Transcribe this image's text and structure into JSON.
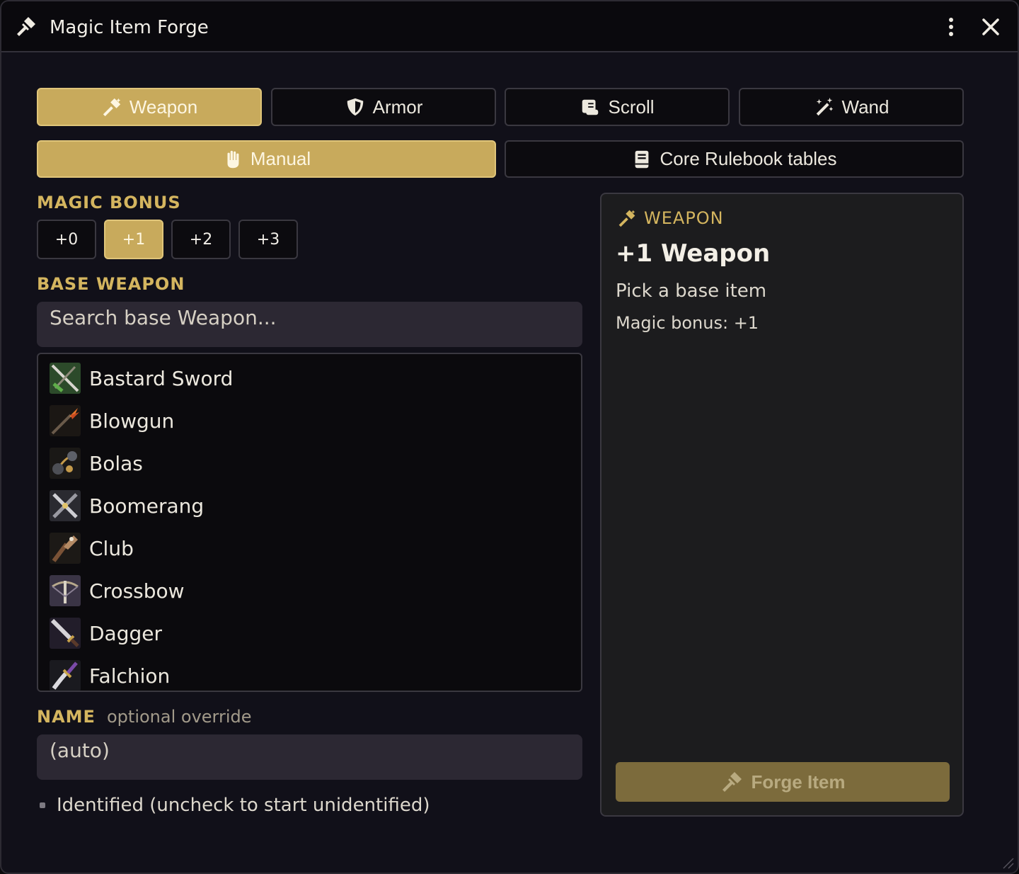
{
  "window": {
    "title": "Magic Item Forge"
  },
  "item_types": [
    {
      "label": "Weapon",
      "icon": "hammer-icon",
      "active": true
    },
    {
      "label": "Armor",
      "icon": "shield-icon",
      "active": false
    },
    {
      "label": "Scroll",
      "icon": "scroll-icon",
      "active": false
    },
    {
      "label": "Wand",
      "icon": "magic-wand-icon",
      "active": false
    }
  ],
  "modes": [
    {
      "label": "Manual",
      "icon": "hand-icon",
      "active": true
    },
    {
      "label": "Core Rulebook tables",
      "icon": "book-icon",
      "active": false
    }
  ],
  "magic_bonus": {
    "label": "MAGIC BONUS",
    "options": [
      "+0",
      "+1",
      "+2",
      "+3"
    ],
    "selected": "+1"
  },
  "base_weapon": {
    "label": "BASE WEAPON",
    "search_placeholder": "Search base Weapon...",
    "items": [
      "Bastard Sword",
      "Blowgun",
      "Bolas",
      "Boomerang",
      "Club",
      "Crossbow",
      "Dagger",
      "Falchion"
    ]
  },
  "name_field": {
    "label": "NAME",
    "hint": "optional override",
    "placeholder": "(auto)"
  },
  "identified_checkbox": {
    "label": "Identified (uncheck to start unidentified)"
  },
  "preview": {
    "kind": "WEAPON",
    "name": "+1 Weapon",
    "hint": "Pick a base item",
    "bonus_line": "Magic bonus: +1"
  },
  "forge_button": {
    "label": "Forge Item"
  },
  "colors": {
    "accent": "#c8aa5c",
    "accent_text": "#d4b55f",
    "window_bg": "#111019",
    "panel_bg": "#1c1c1e",
    "forge_disabled": "#7c6b3c"
  }
}
